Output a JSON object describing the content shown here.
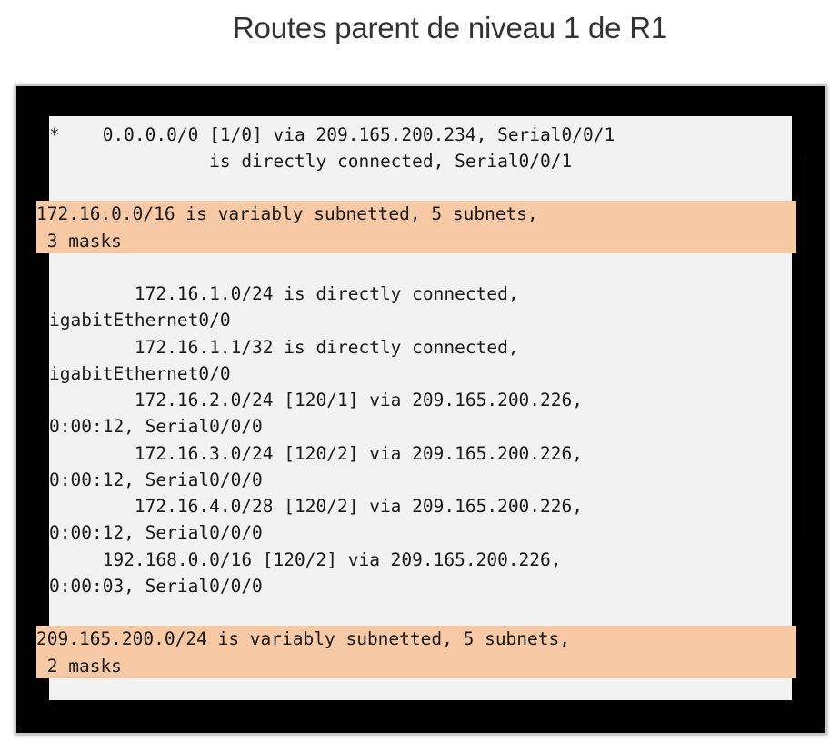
{
  "title": "Routes parent de niveau 1 de R1",
  "terminal": {
    "lines": [
      "*    0.0.0.0/0 [1/0] via 209.165.200.234, Serial0/0/1",
      "               is directly connected, Serial0/0/1",
      "172.16.0.0/16 is variably subnetted, 5 subnets,",
      " 3 masks",
      "        172.16.1.0/24 is directly connected,",
      "igabitEthernet0/0",
      "        172.16.1.1/32 is directly connected,",
      "igabitEthernet0/0",
      "        172.16.2.0/24 [120/1] via 209.165.200.226,",
      "0:00:12, Serial0/0/0",
      "        172.16.3.0/24 [120/2] via 209.165.200.226,",
      "0:00:12, Serial0/0/0",
      "        172.16.4.0/28 [120/2] via 209.165.200.226,",
      "0:00:12, Serial0/0/0",
      "     192.168.0.0/16 [120/2] via 209.165.200.226,",
      "0:00:03, Serial0/0/0",
      "209.165.200.0/24 is variably subnetted, 5 subnets,",
      " 2 masks"
    ]
  },
  "colors": {
    "highlight": "#f7c9a4",
    "terminal_bg": "#f2f2f2",
    "frame": "#000000"
  }
}
